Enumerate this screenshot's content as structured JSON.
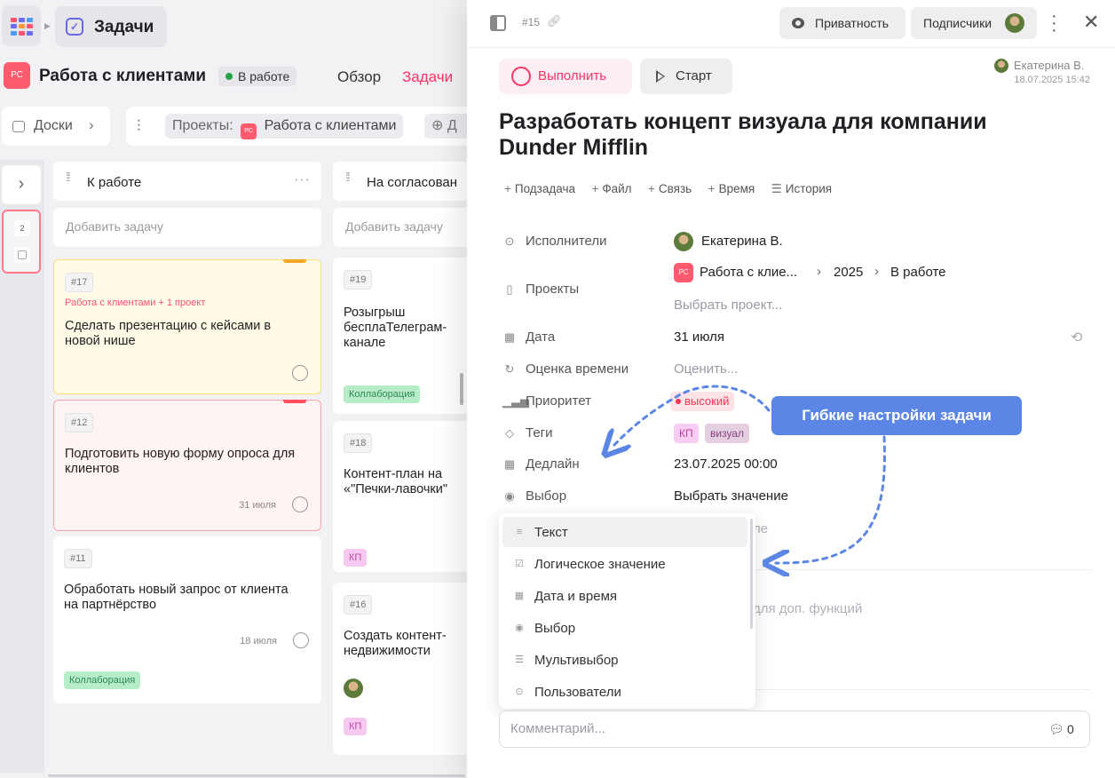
{
  "app": {
    "section_title": "Задачи",
    "project": {
      "avatar": "РС",
      "name": "Работа с клиентами",
      "status": "В работе"
    },
    "nav": {
      "overview": "Обзор",
      "tasks": "Задачи"
    },
    "boards_label": "Доски",
    "filter": {
      "projects_label": "Проекты:",
      "project_avatar": "РС",
      "project_name": "Работа с клиентами",
      "add": "Д"
    },
    "sidebar": {
      "pinned_count": "2"
    },
    "colors": {
      "accent": "#ff3366",
      "status_green": "#22a447",
      "callout": "#5b86e5"
    }
  },
  "board": {
    "columns": [
      {
        "title": "К работе",
        "add_task": "Добавить задачу",
        "cards": [
          {
            "id": "#17",
            "project": "Работа с клиентами + 1 проект",
            "title": "Сделать презентацию с кейсами в новой нише"
          },
          {
            "id": "#12",
            "title": "Подготовить новую форму опроса для клиентов",
            "date": "31 июля"
          },
          {
            "id": "#11",
            "title": "Обработать новый запрос от клиента на партнёрство",
            "date": "18 июля",
            "tag": "Коллаборация"
          }
        ]
      },
      {
        "title": "На согласован",
        "add_task": "Добавить задачу",
        "cards": [
          {
            "id": "#19",
            "title": "Розыгрыш бесплаТелеграм-канале",
            "tag": "Коллаборация"
          },
          {
            "id": "#18",
            "title": "Контент-план на «\"Печки-лавочки\"",
            "tag": "КП"
          },
          {
            "id": "#16",
            "title": "Создать контент-недвижимости",
            "tag": "КП"
          }
        ]
      }
    ]
  },
  "panel": {
    "task_id": "#15",
    "privacy": "Приватность",
    "subscribers": "Подписчики",
    "complete": "Выполнить",
    "start": "Старт",
    "author": {
      "name": "Екатерина В.",
      "date": "18.07.2025 15:42"
    },
    "title": "Разработать концепт визуала для компании Dunder Mifflin",
    "actions": [
      "Подзадача",
      "Файл",
      "Связь",
      "Время",
      "История"
    ],
    "properties": {
      "assignees": {
        "label": "Исполнители",
        "value": "Екатерина В."
      },
      "projects": {
        "label": "Проекты",
        "avatar": "РС",
        "project": "Работа с клие...",
        "year": "2025",
        "stage": "В работе",
        "hint": "Выбрать проект..."
      },
      "date": {
        "label": "Дата",
        "value": "31 июля"
      },
      "estimate": {
        "label": "Оценка времени",
        "hint": "Оценить..."
      },
      "priority": {
        "label": "Приоритет",
        "value": "высокий"
      },
      "tags": {
        "label": "Теги",
        "values": [
          "КП",
          "визуал"
        ]
      },
      "deadline": {
        "label": "Дедлайн",
        "value": "23.07.2025 00:00"
      },
      "choice": {
        "label": "Выбор",
        "value": "Выбрать значение"
      }
    },
    "behind_text": {
      "row1": "ле",
      "row2": "для доп. функций"
    },
    "dropdown": [
      "Текст",
      "Логическое значение",
      "Дата и время",
      "Выбор",
      "Мультивыбор",
      "Пользователи"
    ],
    "comment": {
      "placeholder": "Комментарий...",
      "count": "0"
    }
  },
  "callout": {
    "text": "Гибкие настройки задачи"
  }
}
